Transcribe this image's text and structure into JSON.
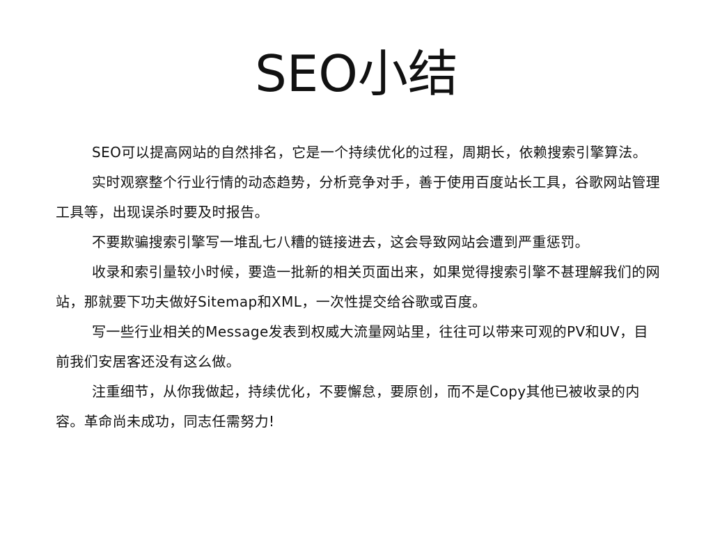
{
  "slide": {
    "title": "SEO小结",
    "paragraphs": [
      "SEO可以提高网站的自然排名，它是一个持续优化的过程，周期长，依赖搜索引擎算法。",
      "实时观察整个行业行情的动态趋势，分析竞争对手，善于使用百度站长工具，谷歌网站管理工具等，出现误杀时要及时报告。",
      "不要欺骗搜索引擎写一堆乱七八糟的链接进去，这会导致网站会遭到严重惩罚。",
      "收录和索引量较小时候，要造一批新的相关页面出来，如果觉得搜索引擎不甚理解我们的网站，那就要下功夫做好Sitemap和XML，一次性提交给谷歌或百度。",
      "写一些行业相关的Message发表到权威大流量网站里，往往可以带来可观的PV和UV，目前我们安居客还没有这么做。",
      "注重细节，从你我做起，持续优化，不要懈怠，要原创，而不是Copy其他已被收录的内容。革命尚未成功，同志任需努力!"
    ]
  }
}
